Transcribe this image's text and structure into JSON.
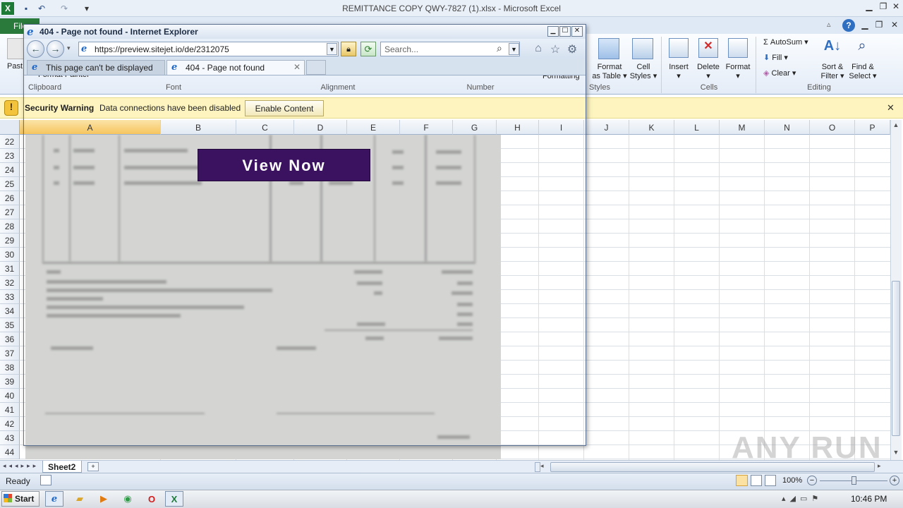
{
  "excel": {
    "title": "REMITTANCE COPY QWY-7827 (1).xlsx - Microsoft Excel",
    "file_tab": "File",
    "ribbon": {
      "paste": "Past",
      "format_painter": "Format Painter",
      "formatting": "Formatting",
      "format_as_table_1": "Format",
      "format_as_table_2": "as Table",
      "cell_styles_1": "Cell",
      "cell_styles_2": "Styles",
      "insert": "Insert",
      "delete": "Delete",
      "format": "Format",
      "autosum": "AutoSum",
      "fill": "Fill",
      "clear": "Clear",
      "sort_filter_1": "Sort &",
      "sort_filter_2": "Filter",
      "find_select_1": "Find &",
      "find_select_2": "Select",
      "groups": {
        "clipboard": "Clipboard",
        "font": "Font",
        "alignment": "Alignment",
        "number": "Number",
        "styles": "Styles",
        "cells": "Cells",
        "editing": "Editing"
      }
    },
    "security": {
      "title": "Security Warning",
      "message": "Data connections have been disabled",
      "button": "Enable Content"
    },
    "columns": [
      "A",
      "B",
      "C",
      "D",
      "E",
      "F",
      "G",
      "H",
      "I",
      "J",
      "K",
      "L",
      "M",
      "N",
      "O",
      "P"
    ],
    "rows": [
      "22",
      "23",
      "24",
      "25",
      "26",
      "27",
      "28",
      "29",
      "30",
      "31",
      "32",
      "33",
      "34",
      "35",
      "36",
      "37",
      "38",
      "39",
      "40",
      "41",
      "42",
      "43",
      "44"
    ],
    "sheet_tab": "Sheet2",
    "status": "Ready",
    "zoom": "100%",
    "view_now": "View Now",
    "watermark": "ANY RUN"
  },
  "ie": {
    "title": "404 - Page not found - Internet Explorer",
    "address": "https://preview.sitejet.io/de/2312075",
    "search_placeholder": "Search...",
    "tabs": [
      "This page can't be displayed",
      "404 - Page not found"
    ]
  },
  "taskbar": {
    "start": "Start",
    "clock": "10:46 PM"
  }
}
